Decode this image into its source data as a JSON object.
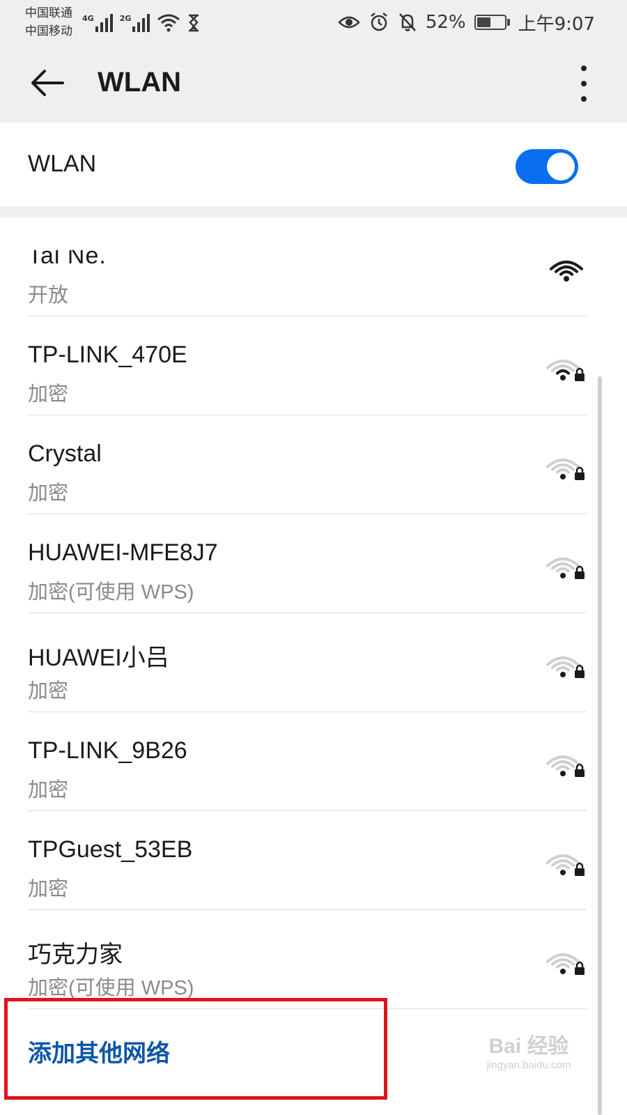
{
  "status_bar": {
    "carrier_1": "中国联通",
    "carrier_2": "中国移动",
    "net_type_1": "4G",
    "net_type_2": "2G",
    "icons_left": [
      "signal-icon",
      "signal-icon",
      "wifi-icon",
      "hourglass-icon"
    ],
    "icons_right": [
      "eye-icon",
      "alarm-icon",
      "bell-off-icon",
      "battery-icon"
    ],
    "battery_percent": "52%",
    "battery_level": 0.52,
    "time": "上午9:07"
  },
  "app_bar": {
    "title": "WLAN",
    "back_icon": "arrow-left-icon",
    "menu_icon": "more-vertical-icon"
  },
  "wlan_toggle": {
    "label": "WLAN",
    "state": "on",
    "accent_color": "#0a6ef0"
  },
  "networks": [
    {
      "name": "Tal Ne.",
      "security": "开放",
      "signal": 4,
      "locked": false
    },
    {
      "name": "TP-LINK_470E",
      "security": "加密",
      "signal": 2,
      "locked": true
    },
    {
      "name": "Crystal",
      "security": "加密",
      "signal": 1,
      "locked": true
    },
    {
      "name": "HUAWEI-MFE8J7",
      "security": "加密(可使用 WPS)",
      "signal": 1,
      "locked": true
    },
    {
      "name": "HUAWEI小吕",
      "security": "加密",
      "signal": 1,
      "locked": true
    },
    {
      "name": "TP-LINK_9B26",
      "security": "加密",
      "signal": 1,
      "locked": true
    },
    {
      "name": "TPGuest_53EB",
      "security": "加密",
      "signal": 1,
      "locked": true
    },
    {
      "name": "巧克力家",
      "security": "加密(可使用 WPS)",
      "signal": 1,
      "locked": true
    }
  ],
  "add_network": {
    "label": "添加其他网络",
    "color": "#0b56a7"
  },
  "annotation": {
    "highlight_color": "#e0121b"
  },
  "watermark": {
    "logo": "Bai 经验",
    "url": "jingyan.baidu.com"
  }
}
